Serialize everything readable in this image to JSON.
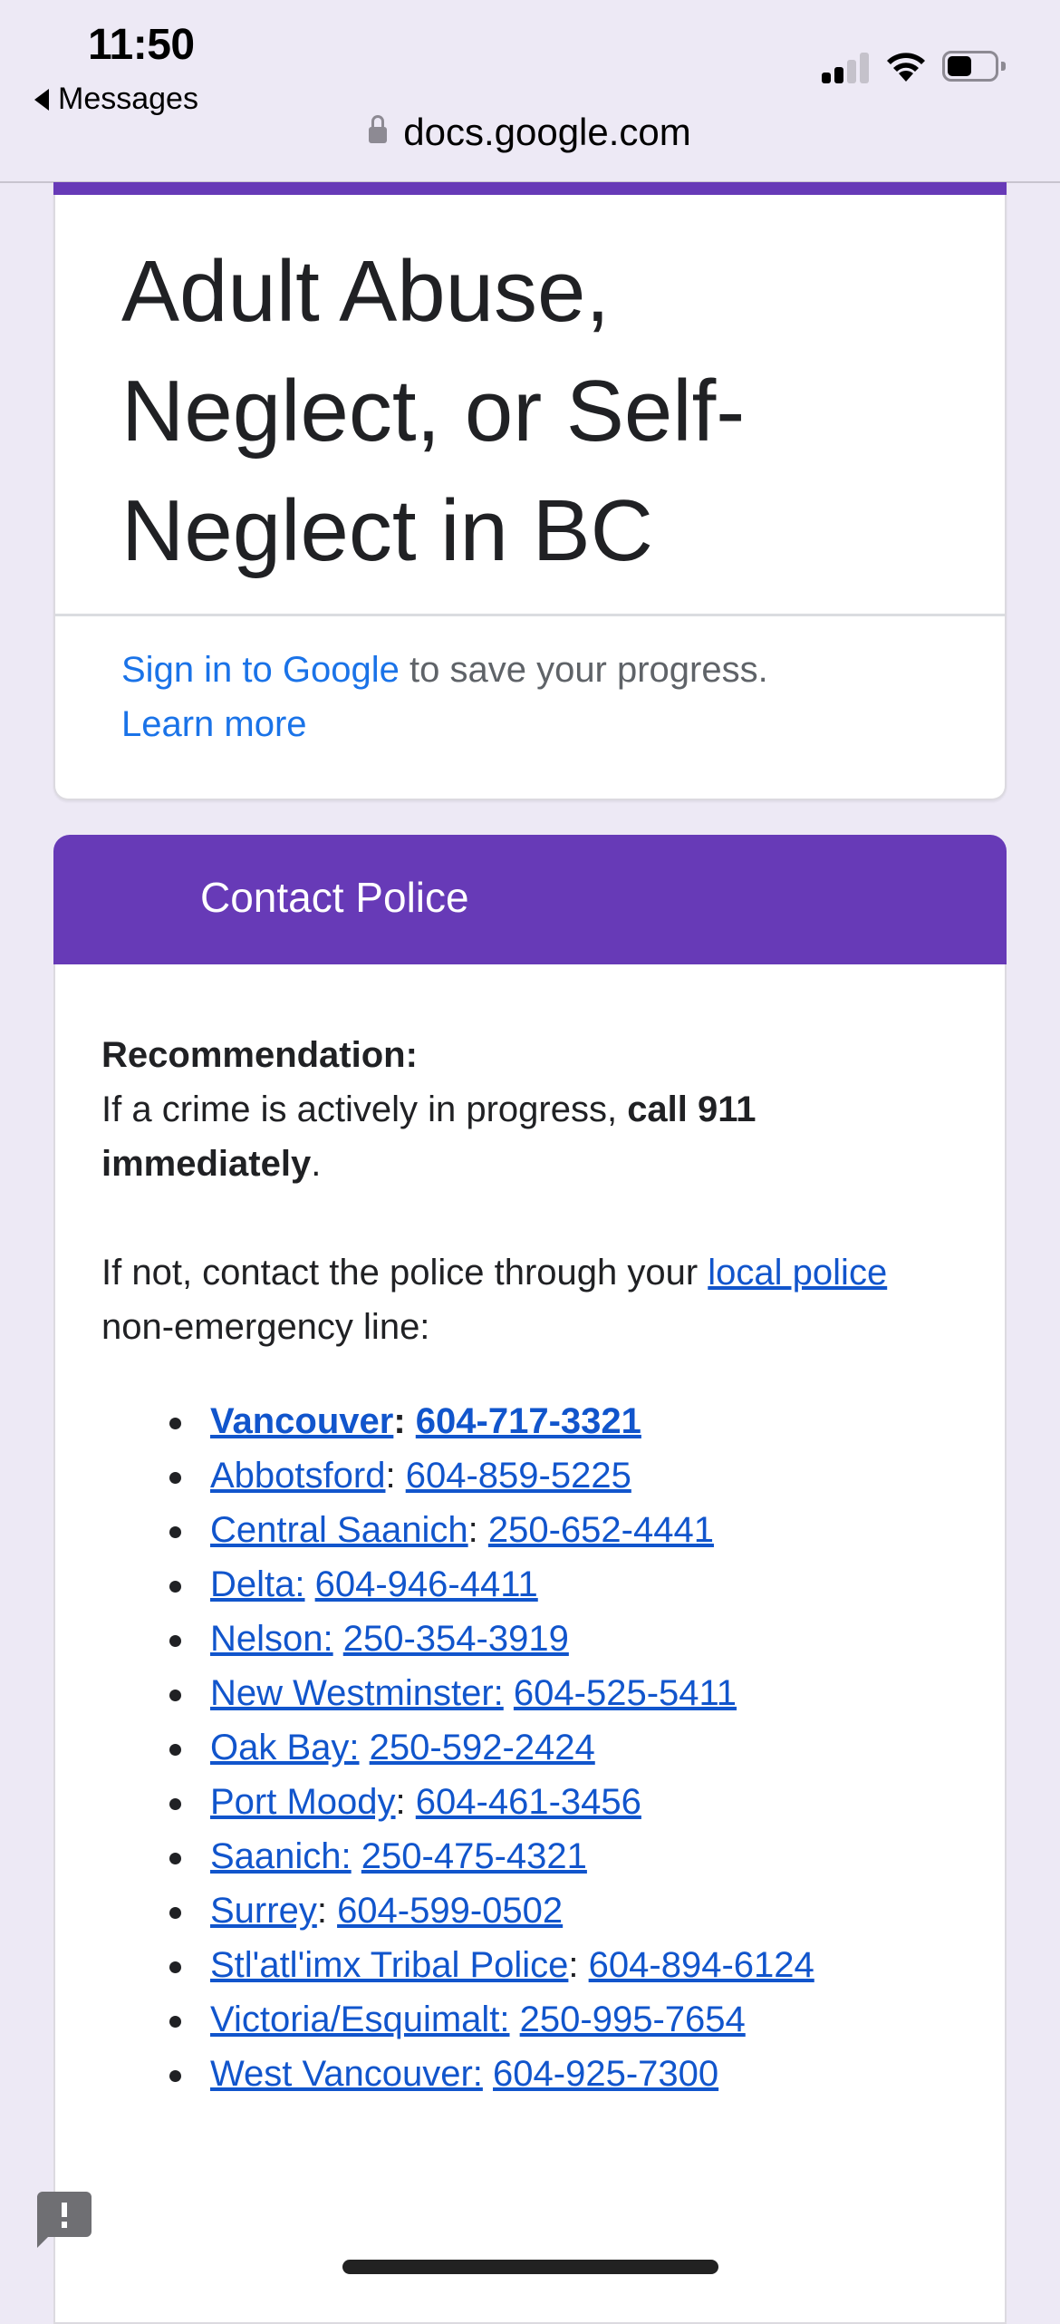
{
  "status_bar": {
    "time": "11:50",
    "back_label": "Messages",
    "signal_bars_active": 2,
    "signal_bars_total": 4,
    "battery_level_percent": 45,
    "icons": [
      "signal-icon",
      "wifi-icon",
      "battery-icon"
    ]
  },
  "url_bar": {
    "domain": "docs.google.com",
    "icon": "lock-icon"
  },
  "form": {
    "accent_color": "#673ab7",
    "title": "Adult Abuse, Neglect, or Self-Neglect in BC",
    "signin_link": "Sign in to Google",
    "signin_text": " to save your progress.",
    "learn_more": "Learn more"
  },
  "section": {
    "header": "Contact Police",
    "recommendation_label": "Recommendation:",
    "crime_text_before": "If a crime is actively in progress, ",
    "crime_text_bold": "call 911 immediately",
    "crime_text_after": ".",
    "not_text_before": "If not, contact the police through your ",
    "local_police_link": "local police",
    "not_text_after": " non-emergency line:",
    "police_lines": [
      {
        "name": "Vancouver",
        "phone": "604-717-3321",
        "bold": true
      },
      {
        "name": "Abbotsford",
        "phone": "604-859-5225"
      },
      {
        "name": "Central Saanich",
        "phone": "250-652-4441"
      },
      {
        "name": "Delta:",
        "phone": "604-946-4411"
      },
      {
        "name": "Nelson:",
        "phone": "250-354-3919"
      },
      {
        "name": "New Westminster:",
        "phone": "604-525-5411"
      },
      {
        "name": "Oak Bay:",
        "phone": "250-592-2424"
      },
      {
        "name": "Port Moody",
        "phone": "604-461-3456"
      },
      {
        "name": "Saanich:",
        "phone": "250-475-4321"
      },
      {
        "name": "Surrey",
        "phone": "604-599-0502"
      },
      {
        "name": "Stl'atl'imx Tribal Police",
        "phone": "604-894-6124"
      },
      {
        "name": "Victoria/Esquimalt:",
        "phone": "250-995-7654"
      },
      {
        "name": "West Vancouver:",
        "phone": "604-925-7300"
      }
    ]
  },
  "feedback": {
    "icon": "report-feedback-icon"
  }
}
